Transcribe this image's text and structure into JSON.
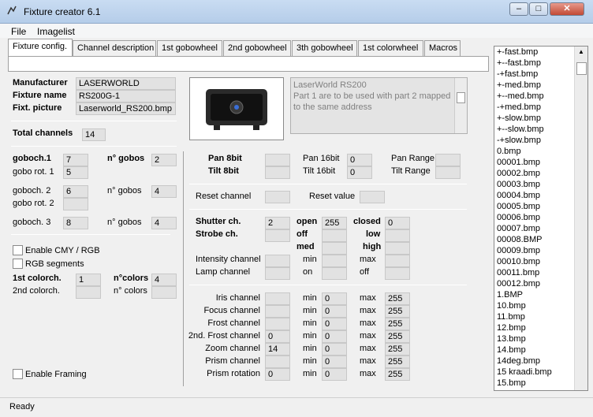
{
  "window": {
    "title": "Fixture creator 6.1"
  },
  "menu": [
    "File",
    "Imagelist"
  ],
  "tabs": [
    "Fixture config.",
    "Channel description",
    "1st gobowheel",
    "2nd gobowheel",
    "3th gobowheel",
    "1st colorwheel",
    "Macros"
  ],
  "fixture": {
    "manufacturer_label": "Manufacturer",
    "manufacturer": "LASERWORLD",
    "name_label": "Fixture name",
    "name": "RS200G-1",
    "picture_label": "Fixt. picture",
    "picture": "Laserworld_RS200.bmp",
    "description": "LaserWorld RS200\nPart 1 are to be used with part 2 mapped to the same address"
  },
  "channels": {
    "label": "Total channels",
    "value": "14"
  },
  "gobo": {
    "goboch1_label": "goboch.1",
    "goboch1": "7",
    "rot1_label": "gobo rot. 1",
    "rot1": "5",
    "ngobos1_label": "n° gobos",
    "ngobos1": "2",
    "goboch2_label": "goboch. 2",
    "goboch2": "6",
    "rot2_label": "gobo rot. 2",
    "rot2": "",
    "ngobos2_label": "n° gobos",
    "ngobos2": "4",
    "goboch3_label": "goboch. 3",
    "goboch3": "8",
    "ngobos3_label": "n° gobos",
    "ngobos3": "4"
  },
  "color": {
    "cmy_label": "Enable CMY / RGB",
    "rgb_label": "RGB segments",
    "col1_label": "1st colorch.",
    "col1": "1",
    "ncolors1_label": "n°colors",
    "ncolors1": "4",
    "col2_label": "2nd colorch.",
    "col2": "",
    "ncolors2_label": "n° colors",
    "ncolors2": ""
  },
  "framing_label": "Enable Framing",
  "pantilt": {
    "pan8_label": "Pan 8bit",
    "pan8": "",
    "tilt8_label": "Tilt 8bit",
    "tilt8": "",
    "pan16_label": "Pan 16bit",
    "pan16": "0",
    "tilt16_label": "Tilt 16bit",
    "tilt16": "0",
    "panrange_label": "Pan Range",
    "panrange": "",
    "tiltrange_label": "Tilt Range",
    "tiltrange": ""
  },
  "reset": {
    "channel_label": "Reset channel",
    "channel": "",
    "value_label": "Reset value",
    "value": ""
  },
  "shutter": {
    "shutter_label": "Shutter ch.",
    "shutter": "2",
    "strobe_label": "Strobe ch.",
    "open_label": "open",
    "open": "255",
    "closed_label": "closed",
    "closed": "0",
    "off_label": "off",
    "low_label": "low",
    "med_label": "med",
    "high_label": "high",
    "intensity_label": "Intensity channel",
    "min_label": "min",
    "max_label": "max",
    "lamp_label": "Lamp channel",
    "on_label": "on",
    "off2_label": "off"
  },
  "beam": [
    {
      "label": "Iris channel",
      "ch": "",
      "min": "0",
      "max": "255"
    },
    {
      "label": "Focus channel",
      "ch": "",
      "min": "0",
      "max": "255"
    },
    {
      "label": "Frost channel",
      "ch": "",
      "min": "0",
      "max": "255"
    },
    {
      "label": "2nd. Frost channel",
      "ch": "0",
      "min": "0",
      "max": "255"
    },
    {
      "label": "Zoom channel",
      "ch": "14",
      "min": "0",
      "max": "255"
    },
    {
      "label": "Prism channel",
      "ch": "",
      "min": "0",
      "max": "255"
    },
    {
      "label": "Prism rotation",
      "ch": "0",
      "min": "0",
      "max": "255"
    }
  ],
  "beam_min_label": "min",
  "beam_max_label": "max",
  "imagelist": [
    "+-fast.bmp",
    "+--fast.bmp",
    "-+fast.bmp",
    "+-med.bmp",
    "+--med.bmp",
    "-+med.bmp",
    "+-slow.bmp",
    "+--slow.bmp",
    "-+slow.bmp",
    "0.bmp",
    "00001.bmp",
    "00002.bmp",
    "00003.bmp",
    "00004.bmp",
    "00005.bmp",
    "00006.bmp",
    "00007.bmp",
    "00008.BMP",
    "00009.bmp",
    "00010.bmp",
    "00011.bmp",
    "00012.bmp",
    "1.BMP",
    "10.bmp",
    "11.bmp",
    "12.bmp",
    "13.bmp",
    "14.bmp",
    "14deg.bmp",
    "15 kraadi.bmp",
    "15.bmp"
  ],
  "status": "Ready"
}
